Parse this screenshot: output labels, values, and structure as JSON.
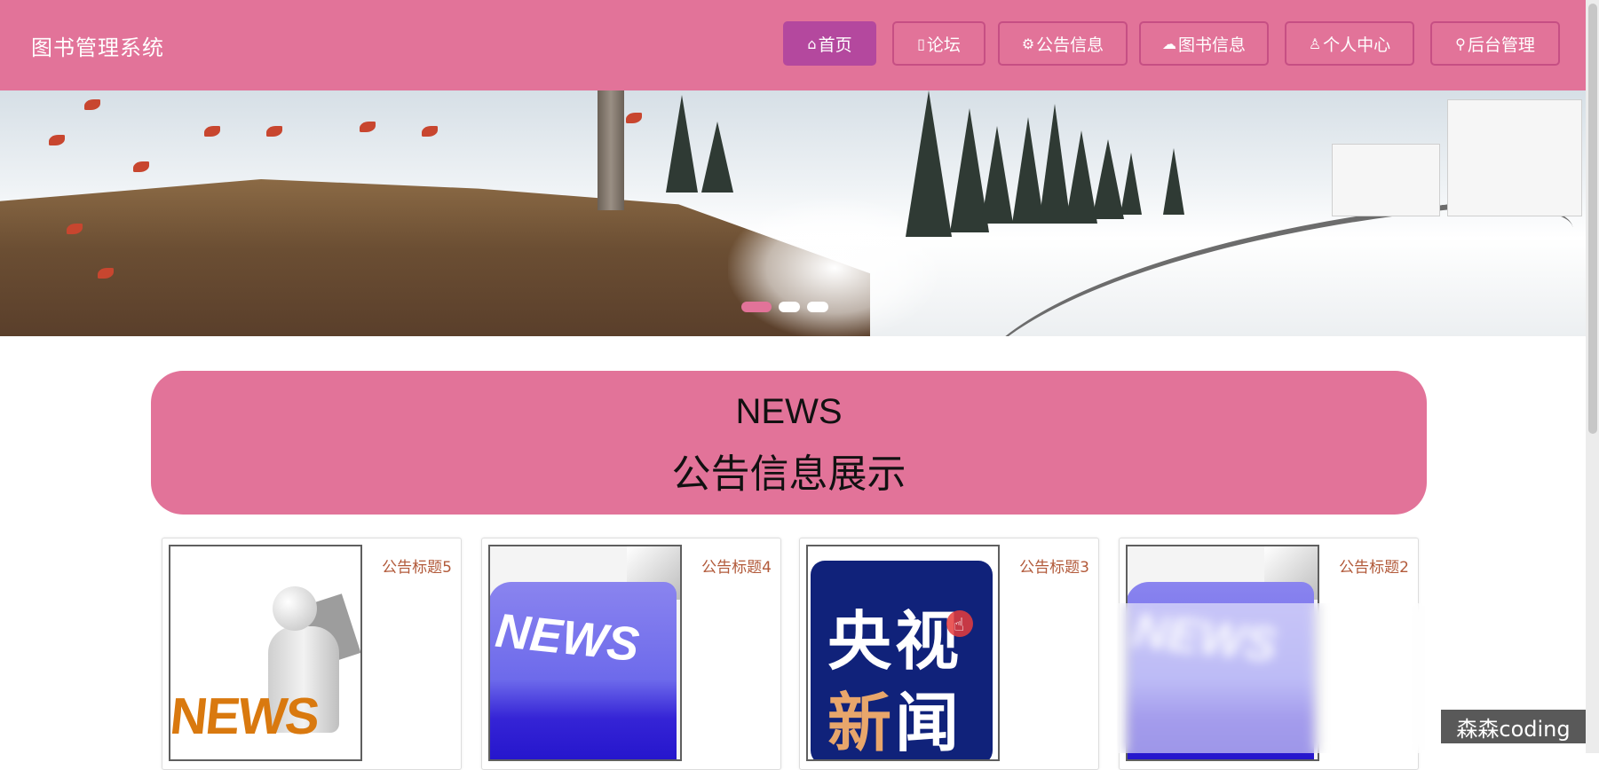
{
  "app": {
    "brand": "图书管理系统"
  },
  "nav": [
    {
      "icon": "home-icon",
      "glyph": "⌂",
      "label": "首页",
      "active": true
    },
    {
      "icon": "forum-icon",
      "glyph": "▯",
      "label": "论坛",
      "active": false
    },
    {
      "icon": "announcement-icon",
      "glyph": "⚙",
      "label": "公告信息",
      "active": false
    },
    {
      "icon": "cloud-icon",
      "glyph": "☁",
      "label": "图书信息",
      "active": false
    },
    {
      "icon": "user-icon",
      "glyph": "♙",
      "label": "个人中心",
      "active": false
    },
    {
      "icon": "link-icon",
      "glyph": "⚲",
      "label": "后台管理",
      "active": false
    }
  ],
  "carousel": {
    "slide_count": 3,
    "active_index": 0
  },
  "section": {
    "title_en": "NEWS",
    "title_zh": "公告信息展示"
  },
  "cards": [
    {
      "title": "公告标题5",
      "image": "news-3d-figure"
    },
    {
      "title": "公告标题4",
      "image": "news-key"
    },
    {
      "title": "公告标题3",
      "image": "cctv-news",
      "image_text_top": "央视",
      "image_text_bottom_a": "新",
      "image_text_bottom_b": "闻"
    },
    {
      "title": "公告标题2",
      "image": "news-key"
    }
  ],
  "image_words": {
    "news": "NEWS"
  },
  "watermark": "森森coding",
  "colors": {
    "primary": "#e27399",
    "active_nav": "#b4489e",
    "card_title": "#b25a3a"
  }
}
